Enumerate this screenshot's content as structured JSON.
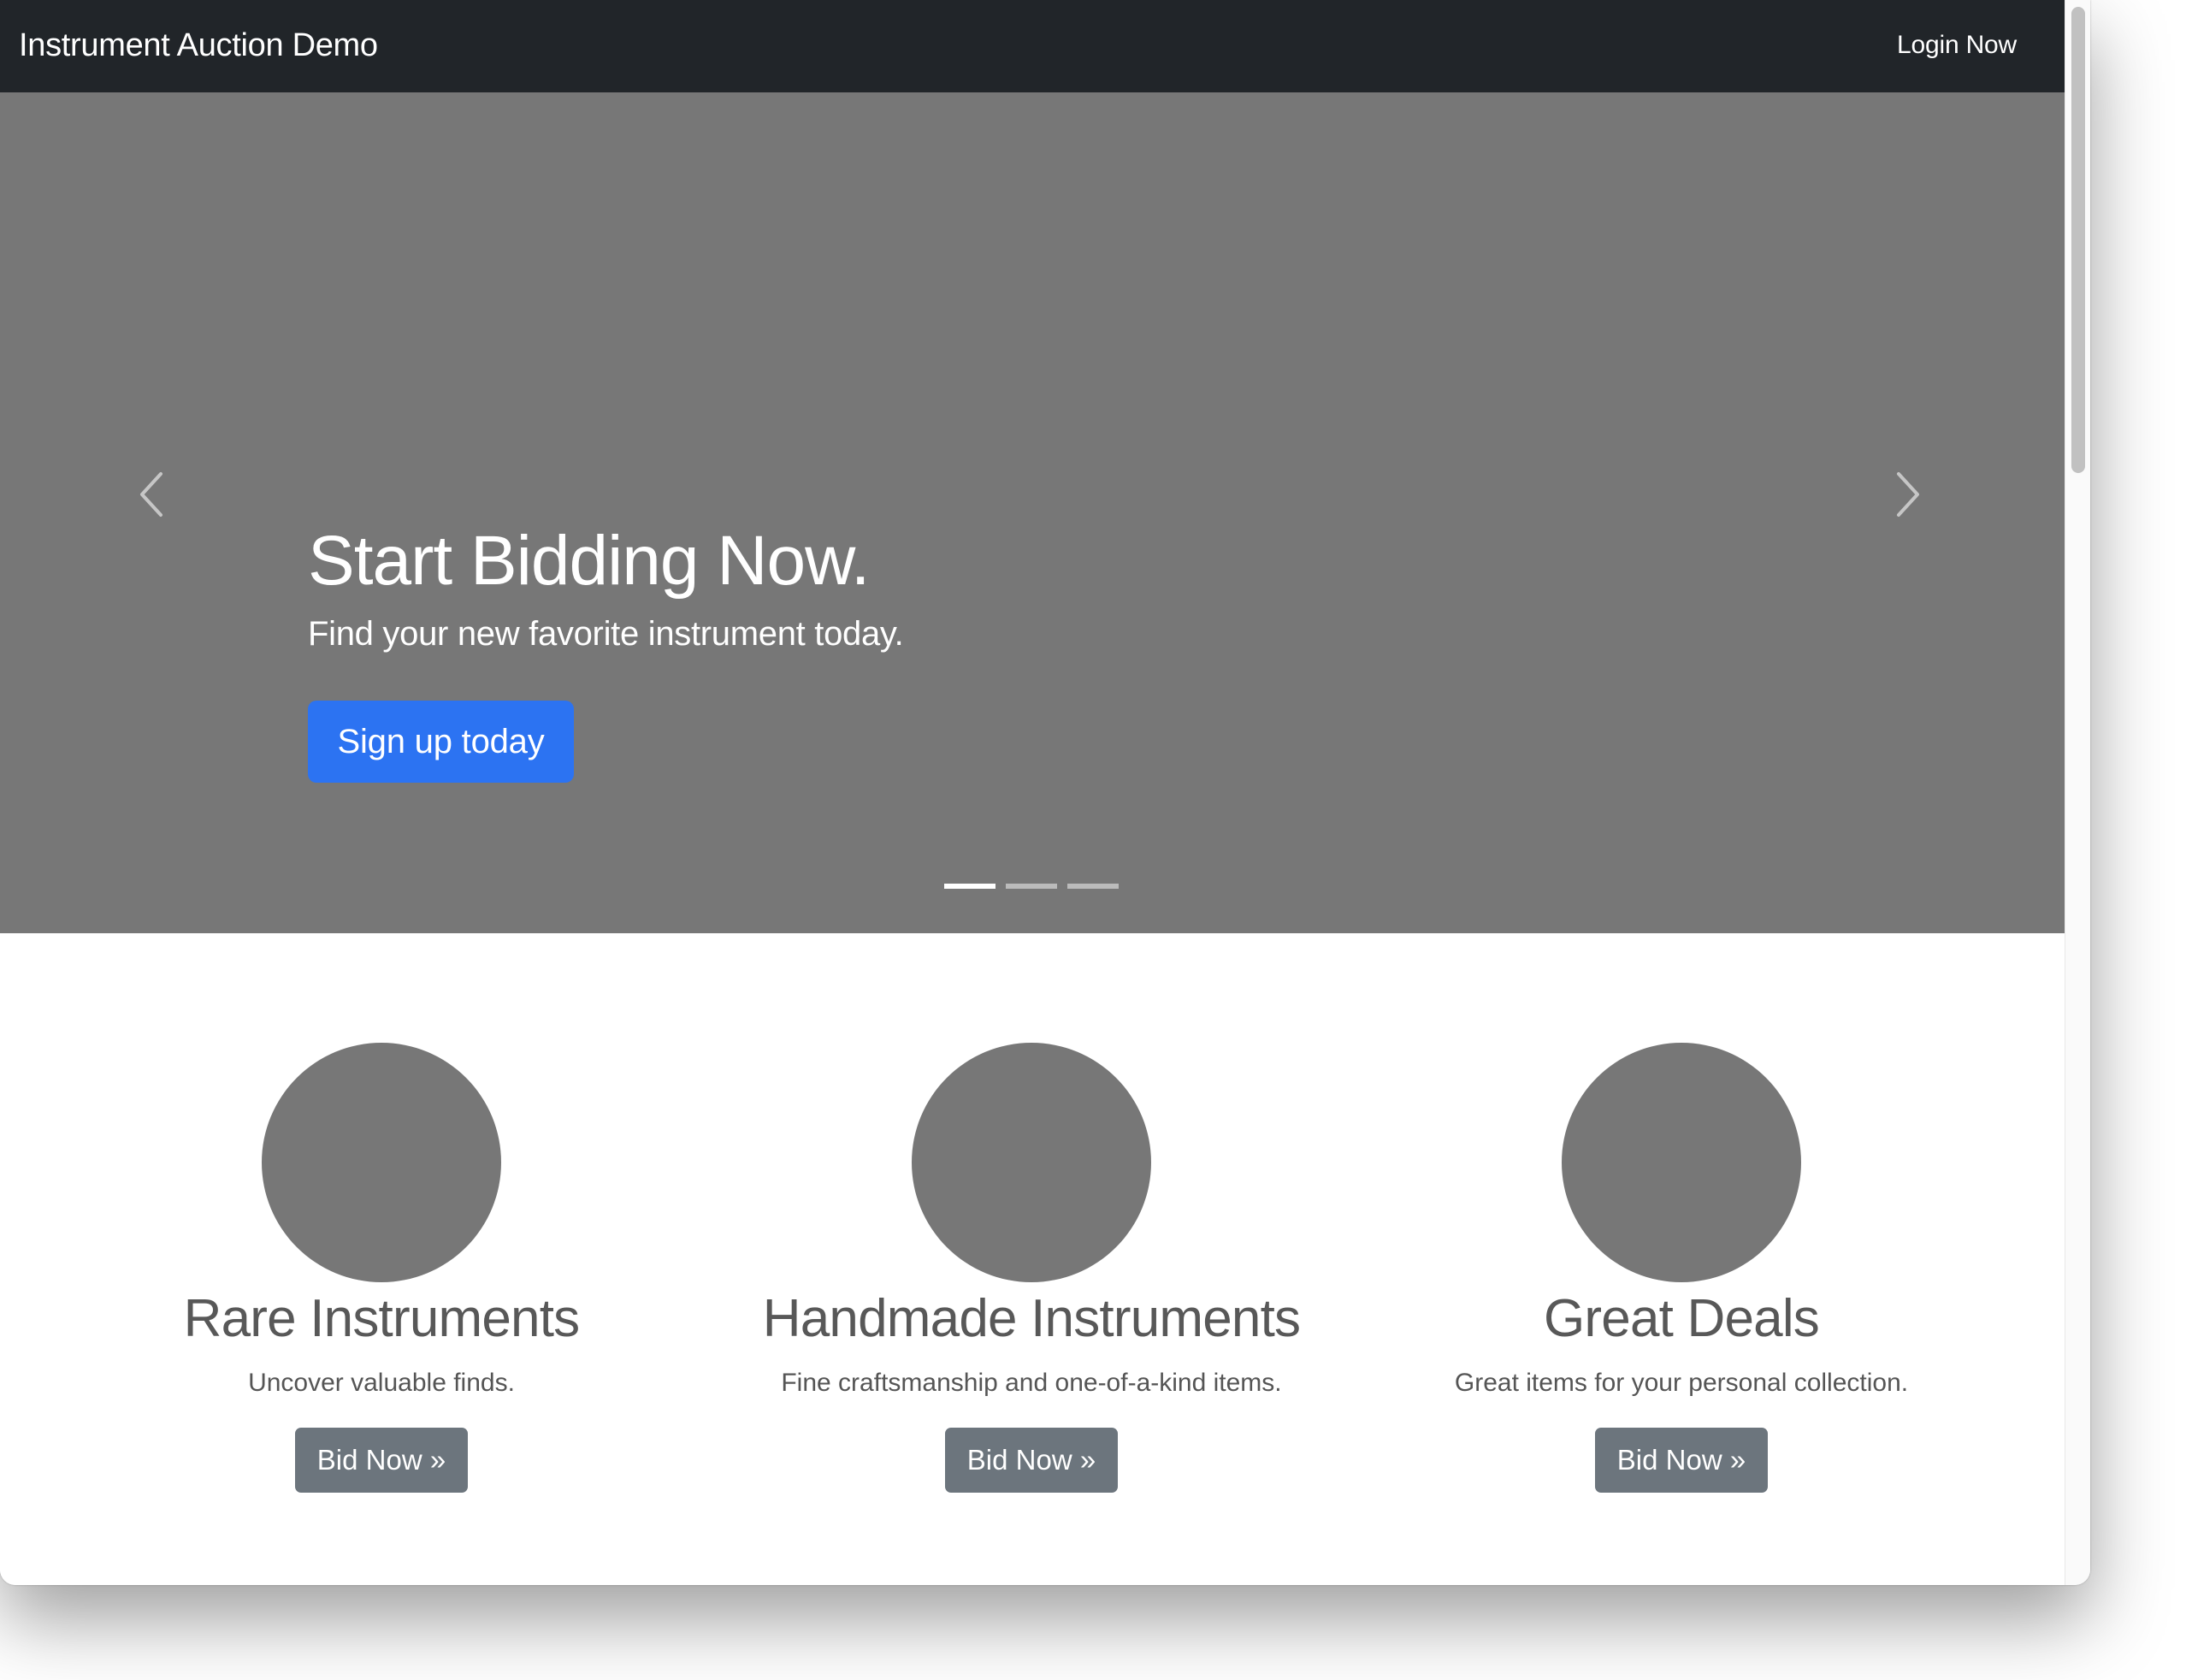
{
  "navbar": {
    "brand": "Instrument Auction Demo",
    "login_label": "Login Now",
    "background": "#212529"
  },
  "carousel": {
    "slides": [
      {
        "heading": "Start Bidding Now.",
        "subheading": "Find your new favorite instrument today.",
        "cta_label": "Sign up today"
      }
    ],
    "active_slide": 1,
    "slide_count": 3,
    "prev_icon": "chevron-left-icon",
    "next_icon": "chevron-right-icon",
    "background": "#777777",
    "cta_color": "#2c73f2"
  },
  "features": [
    {
      "title": "Rare Instruments",
      "description": "Uncover valuable finds.",
      "button_label": "Bid Now »"
    },
    {
      "title": "Handmade Instruments",
      "description": "Fine craftsmanship and one-of-a-kind items.",
      "button_label": "Bid Now »"
    },
    {
      "title": "Great Deals",
      "description": "Great items for your personal collection.",
      "button_label": "Bid Now »"
    }
  ],
  "colors": {
    "secondary_button": "#6c757d",
    "placeholder_circle": "#777777"
  }
}
